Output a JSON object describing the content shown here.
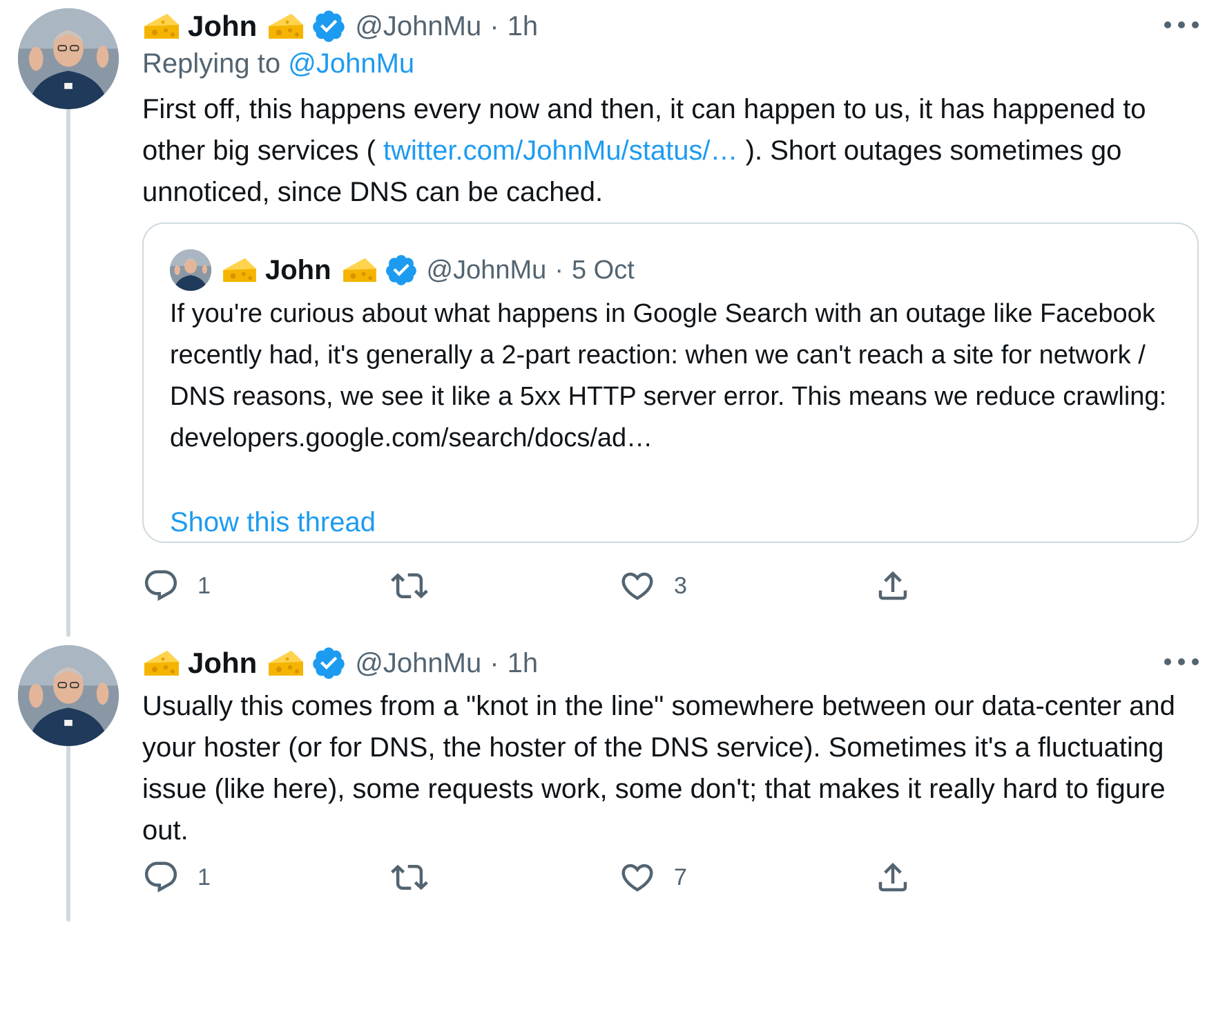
{
  "tweets": [
    {
      "author": {
        "name": "John",
        "handle": "@JohnMu",
        "verified": true,
        "name_emoji": "cheese-icon"
      },
      "separator": "·",
      "time": "1h",
      "replying": {
        "prefix": "Replying to",
        "to": "@JohnMu"
      },
      "text_parts": [
        "First off, this happens every now and then, it can happen to us, it has happened to other big services ( ",
        "twitter.com/JohnMu/status/…",
        " ). Short outages sometimes go unnoticed, since DNS can be cached."
      ],
      "quote": {
        "author": {
          "name": "John",
          "handle": "@JohnMu",
          "verified": true
        },
        "separator": "·",
        "date": "5 Oct",
        "text": "If you're curious about what happens in Google Search with an outage like Facebook recently had, it's generally a 2-part reaction: when we can't reach a site for network / DNS reasons, we see it like a 5xx HTTP server error. This means we reduce crawling: developers.google.com/search/docs/ad…",
        "show_thread": "Show this thread"
      },
      "actions": {
        "replies": "1",
        "retweets": "",
        "likes": "3"
      }
    },
    {
      "author": {
        "name": "John",
        "handle": "@JohnMu",
        "verified": true,
        "name_emoji": "cheese-icon"
      },
      "separator": "·",
      "time": "1h",
      "text": "Usually this comes from a \"knot in the line\" somewhere between our data-center and your hoster (or for DNS, the hoster of the DNS service). Sometimes it's a fluctuating issue (like here), some requests work, some don't; that makes it really hard to figure out.",
      "actions": {
        "replies": "1",
        "retweets": "",
        "likes": "7"
      }
    }
  ],
  "colors": {
    "link": "#1d9bf0",
    "muted": "#536471",
    "text": "#0f1419",
    "border": "#cfd9de",
    "verified": "#1d9bf0"
  }
}
